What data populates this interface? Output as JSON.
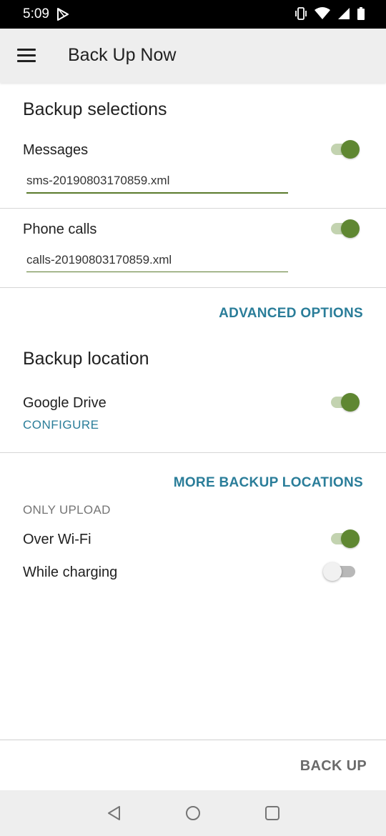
{
  "status_bar": {
    "time": "5:09",
    "icons": [
      "play-store-icon",
      "vibrate-icon",
      "wifi-icon",
      "signal-icon",
      "battery-icon"
    ]
  },
  "toolbar": {
    "title": "Back Up Now",
    "menu_icon": "menu-icon"
  },
  "backup_selections": {
    "title": "Backup selections",
    "messages": {
      "label": "Messages",
      "filename": "sms-20190803170859.xml",
      "enabled": true
    },
    "phone_calls": {
      "label": "Phone calls",
      "filename": "calls-20190803170859.xml",
      "enabled": true
    },
    "advanced_options_label": "ADVANCED OPTIONS"
  },
  "backup_location": {
    "title": "Backup location",
    "google_drive": {
      "label": "Google Drive",
      "configure_label": "CONFIGURE",
      "enabled": true
    },
    "more_locations_label": "MORE BACKUP LOCATIONS"
  },
  "upload": {
    "caption": "ONLY UPLOAD",
    "over_wifi": {
      "label": "Over Wi-Fi",
      "enabled": true
    },
    "while_charging": {
      "label": "While charging",
      "enabled": false
    }
  },
  "actions": {
    "back_up_label": "BACK UP"
  },
  "nav_bar": {
    "icons": [
      "back-icon",
      "home-icon",
      "recents-icon"
    ]
  },
  "colors": {
    "accent_green": "#5f8732",
    "link_blue": "#2a7d99",
    "toolbar_bg": "#eeeeee"
  }
}
